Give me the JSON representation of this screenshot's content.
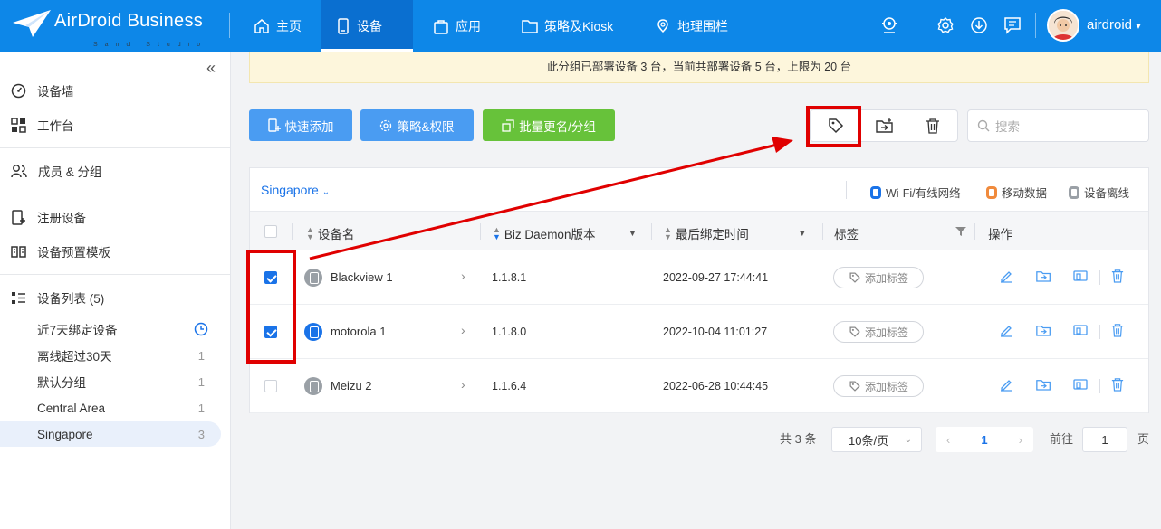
{
  "brand": {
    "name": "AirDroid Business",
    "subtitle": "Sand Studio"
  },
  "topnav": [
    {
      "label": "主页",
      "icon": "home-icon"
    },
    {
      "label": "设备",
      "icon": "device-icon",
      "active": true
    },
    {
      "label": "应用",
      "icon": "app-bag-icon"
    },
    {
      "label": "策略及Kiosk",
      "icon": "folder-icon"
    },
    {
      "label": "地理围栏",
      "icon": "geofence-icon"
    }
  ],
  "user": {
    "name": "airdroid"
  },
  "sidebar": {
    "items": [
      {
        "label": "设备墙",
        "icon": "dashboard-icon"
      },
      {
        "label": "工作台",
        "icon": "workbench-icon"
      },
      {
        "label": "成员 & 分组",
        "icon": "members-icon"
      },
      {
        "label": "注册设备",
        "icon": "register-device-icon"
      },
      {
        "label": "设备预置模板",
        "icon": "template-icon"
      },
      {
        "label": "设备列表 (5)",
        "icon": "list-icon"
      }
    ],
    "groups": [
      {
        "label": "近7天绑定设备",
        "count": ""
      },
      {
        "label": "离线超过30天",
        "count": "1"
      },
      {
        "label": "默认分组",
        "count": "1"
      },
      {
        "label": "Central Area",
        "count": "1"
      },
      {
        "label": "Singapore",
        "count": "3"
      }
    ]
  },
  "notice": "此分组已部署设备 3 台，当前共部署设备 5 台，上限为 20 台",
  "toolbar": {
    "quick_add": "快速添加",
    "policy": "策略&权限",
    "batch_rename": "批量更名/分组",
    "search_placeholder": "搜索"
  },
  "group_selector": "Singapore",
  "legend": [
    {
      "label": "Wi-Fi/有线网络",
      "color": "#1a73e8"
    },
    {
      "label": "移动数据",
      "color": "#f08a3c"
    },
    {
      "label": "设备离线",
      "color": "#9aa0a6"
    }
  ],
  "table": {
    "headers": {
      "name": "设备名",
      "daemon": "Biz Daemon版本",
      "bind_time": "最后绑定时间",
      "tags": "标签",
      "actions": "操作"
    },
    "rows": [
      {
        "name": "Blackview 1",
        "version": "1.1.8.1",
        "time": "2022-09-27 17:44:41",
        "tag": "添加标签",
        "checked": true,
        "status_color": "#9aa0a6"
      },
      {
        "name": "motorola 1",
        "version": "1.1.8.0",
        "time": "2022-10-04 11:01:27",
        "tag": "添加标签",
        "checked": true,
        "status_color": "#1a73e8"
      },
      {
        "name": "Meizu 2",
        "version": "1.1.6.4",
        "time": "2022-06-28 10:44:45",
        "tag": "添加标签",
        "checked": false,
        "status_color": "#9aa0a6"
      }
    ]
  },
  "pagination": {
    "total": "共 3 条",
    "page_size": "10条/页",
    "current": "1",
    "goto_label": "前往",
    "goto_value": "1",
    "page_suffix": "页"
  }
}
